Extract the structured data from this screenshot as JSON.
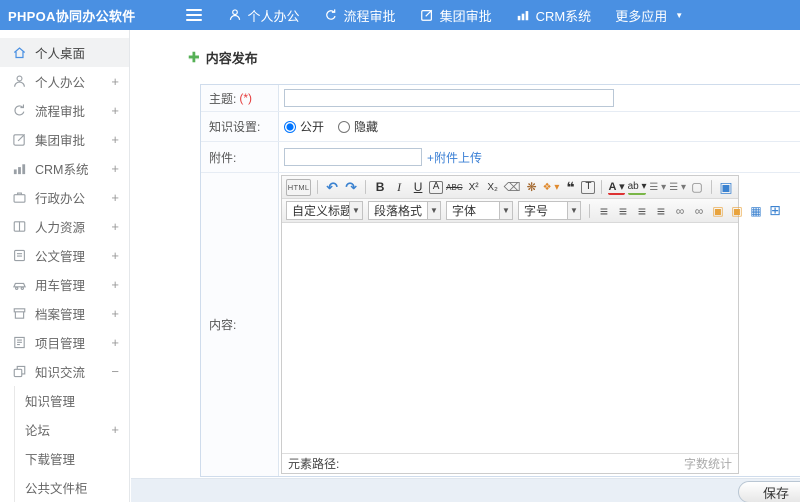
{
  "topbar": {
    "logo": "PHPOA协同办公软件",
    "nav": [
      {
        "icon": "person-icon",
        "label": "个人办公"
      },
      {
        "icon": "process-icon",
        "label": "流程审批"
      },
      {
        "icon": "edit-icon",
        "label": "集团审批"
      },
      {
        "icon": "chart-icon",
        "label": "CRM系统"
      },
      {
        "icon": "caret-down-icon",
        "label": "更多应用"
      }
    ]
  },
  "sidebar": {
    "items": [
      {
        "icon": "home-icon",
        "label": "个人桌面",
        "expand": "",
        "active": true
      },
      {
        "icon": "person-icon",
        "label": "个人办公",
        "expand": "+"
      },
      {
        "icon": "process-icon",
        "label": "流程审批",
        "expand": "+"
      },
      {
        "icon": "edit-icon",
        "label": "集团审批",
        "expand": "+"
      },
      {
        "icon": "chart-icon",
        "label": "CRM系统",
        "expand": "+"
      },
      {
        "icon": "briefcase-icon",
        "label": "行政办公",
        "expand": "+"
      },
      {
        "icon": "book-icon",
        "label": "人力资源",
        "expand": "+"
      },
      {
        "icon": "document-icon",
        "label": "公文管理",
        "expand": "+"
      },
      {
        "icon": "car-icon",
        "label": "用车管理",
        "expand": "+"
      },
      {
        "icon": "archive-icon",
        "label": "档案管理",
        "expand": "+"
      },
      {
        "icon": "project-icon",
        "label": "项目管理",
        "expand": "+"
      },
      {
        "icon": "layers-icon",
        "label": "知识交流",
        "expand": "−"
      },
      {
        "label": "知识管理",
        "sub": true,
        "expand": ""
      },
      {
        "label": "论坛",
        "sub": true,
        "expand": "+"
      },
      {
        "label": "下载管理",
        "sub": true,
        "expand": ""
      },
      {
        "label": "公共文件柜",
        "sub": true,
        "expand": ""
      }
    ]
  },
  "main": {
    "page_title": "内容发布",
    "form": {
      "subject_label": "主题:",
      "required_mark": "(*)",
      "subject_value": "",
      "knowledge_label": "知识设置:",
      "radio_public": "公开",
      "radio_hidden": "隐藏",
      "knowledge_selected": "公开",
      "attachment_label": "附件:",
      "attachment_value": "",
      "upload_link": "+附件上传",
      "content_label": "内容:"
    },
    "editor": {
      "selects": [
        {
          "name": "custom-heading-select",
          "label": "自定义标题"
        },
        {
          "name": "paragraph-format-select",
          "label": "段落格式"
        },
        {
          "name": "font-family-select",
          "label": "字体"
        },
        {
          "name": "font-size-select",
          "label": "字号"
        }
      ],
      "row1": [
        {
          "name": "html-source-button",
          "glyph": "HTML",
          "cls": "t-html"
        },
        {
          "name": "toolbar-separator",
          "glyph": "",
          "cls": "t-sep"
        },
        {
          "name": "undo-icon",
          "glyph": "↶",
          "cls": "t-blue t-lg t-bold"
        },
        {
          "name": "redo-icon",
          "glyph": "↷",
          "cls": "t-blue t-lg t-bold"
        },
        {
          "name": "toolbar-separator",
          "glyph": "",
          "cls": "t-sep"
        },
        {
          "name": "bold-icon",
          "glyph": "B",
          "cls": "t-bold"
        },
        {
          "name": "italic-icon",
          "glyph": "I",
          "cls": "t-italic"
        },
        {
          "name": "underline-icon",
          "glyph": "U",
          "cls": "t-underline"
        },
        {
          "name": "char-border-icon",
          "glyph": "A",
          "cls": "t-boxed"
        },
        {
          "name": "strikethrough-icon",
          "glyph": "ABC",
          "cls": "t-strike"
        },
        {
          "name": "superscript-icon",
          "glyph": "X²",
          "cls": "t-small"
        },
        {
          "name": "subscript-icon",
          "glyph": "X₂",
          "cls": "t-small"
        },
        {
          "name": "eraser-icon",
          "glyph": "⌫",
          "cls": "t-gray"
        },
        {
          "name": "clean-format-icon",
          "glyph": "❋",
          "cls": "t-brown"
        },
        {
          "name": "format-painter-icon",
          "glyph": "❖ ▾",
          "cls": "t-orange t-small"
        },
        {
          "name": "blockquote-icon",
          "glyph": "❝",
          "cls": "t-bold t-lg"
        },
        {
          "name": "paste-text-icon",
          "glyph": "T",
          "cls": "t-boxed"
        },
        {
          "name": "toolbar-separator",
          "glyph": "",
          "cls": "t-sep"
        },
        {
          "name": "font-color-icon",
          "glyph": "A ▾",
          "cls": "t-fontcolor"
        },
        {
          "name": "highlight-color-icon",
          "glyph": "ab ▾",
          "cls": "t-highlight"
        },
        {
          "name": "ordered-list-icon",
          "glyph": "☰ ▾",
          "cls": "t-gray t-small"
        },
        {
          "name": "unordered-list-icon",
          "glyph": "☰ ▾",
          "cls": "t-gray t-small"
        },
        {
          "name": "new-document-icon",
          "glyph": "▢",
          "cls": "t-gray"
        },
        {
          "name": "toolbar-separator",
          "glyph": "",
          "cls": "t-sep"
        },
        {
          "name": "preview-icon",
          "glyph": "▣",
          "cls": "t-blue t-lg"
        }
      ],
      "row2_icons": [
        {
          "name": "toolbar-separator",
          "glyph": "",
          "cls": "t-sep"
        },
        {
          "name": "align-left-icon",
          "glyph": "≡",
          "cls": "t-dkgray t-lg"
        },
        {
          "name": "align-center-icon",
          "glyph": "≡",
          "cls": "t-dkgray t-lg"
        },
        {
          "name": "align-right-icon",
          "glyph": "≡",
          "cls": "t-dkgray t-lg"
        },
        {
          "name": "align-justify-icon",
          "glyph": "≡",
          "cls": "t-dkgray t-lg"
        },
        {
          "name": "link-icon",
          "glyph": "∞",
          "cls": "t-gray"
        },
        {
          "name": "unlink-icon",
          "glyph": "∞",
          "cls": "t-gray"
        },
        {
          "name": "image-icon",
          "glyph": "▣",
          "cls": "t-orangebg"
        },
        {
          "name": "insert-image-icon",
          "glyph": "▣",
          "cls": "t-orangebg"
        },
        {
          "name": "media-icon",
          "glyph": "▦",
          "cls": "t-blue"
        },
        {
          "name": "table-icon",
          "glyph": "⊞",
          "cls": "t-blue t-lg"
        }
      ],
      "statusbar_left": "元素路径:",
      "statusbar_right": "字数统计"
    },
    "save_button": "保存"
  },
  "colors": {
    "topbar_blue": "#4a90e2",
    "accent_green": "#55b055",
    "link_blue": "#3a7fd5",
    "required_red": "#e53c3c",
    "form_border": "#cfdcec"
  }
}
